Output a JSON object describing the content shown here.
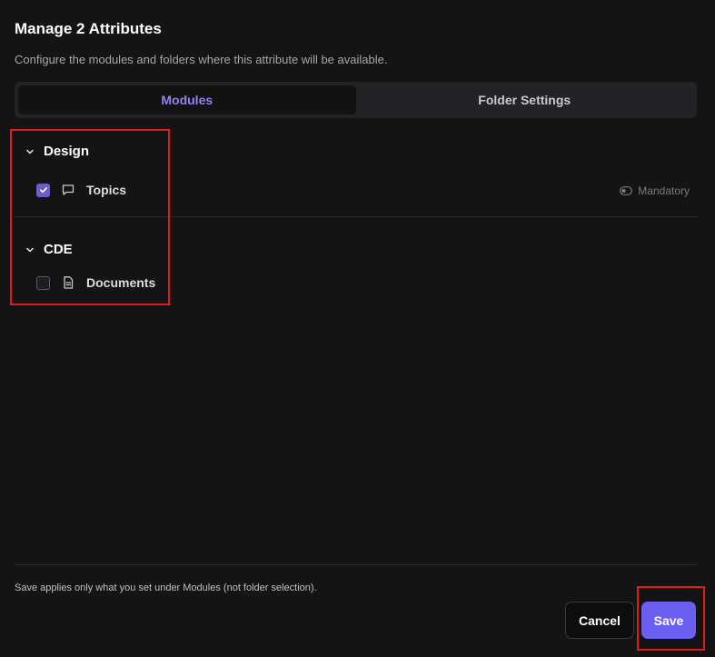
{
  "dialog": {
    "title": "Manage 2 Attributes",
    "subtitle": "Configure the modules and folders where this attribute will be available."
  },
  "tabs": [
    {
      "label": "Modules",
      "active": true
    },
    {
      "label": "Folder Settings",
      "active": false
    }
  ],
  "groups": [
    {
      "label": "Design",
      "items": [
        {
          "label": "Topics",
          "checked": true,
          "icon": "comment-icon",
          "toggle_label": "Mandatory"
        }
      ]
    },
    {
      "label": "CDE",
      "items": [
        {
          "label": "Documents",
          "checked": false,
          "icon": "document-icon"
        }
      ]
    }
  ],
  "footer": {
    "note": "Save applies only what you set under Modules (not folder selection).",
    "cancel_label": "Cancel",
    "save_label": "Save"
  },
  "colors": {
    "accent": "#6a5ff0",
    "highlight": "#e01b1b",
    "background": "#141414"
  }
}
